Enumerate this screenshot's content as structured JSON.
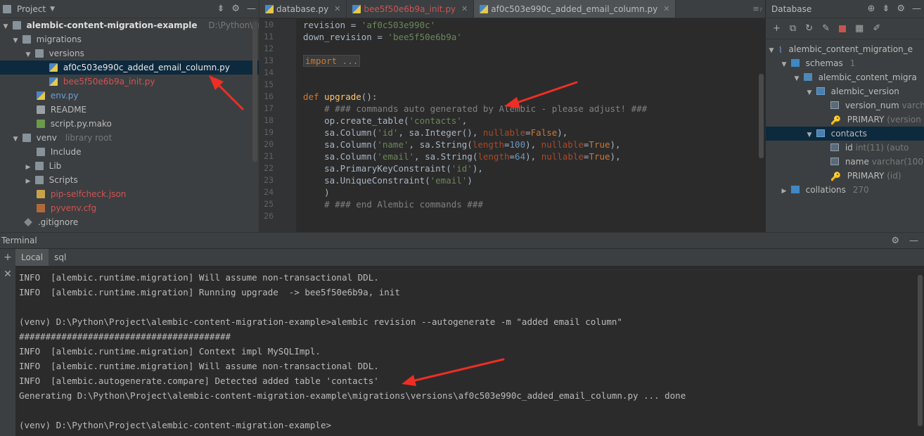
{
  "project": {
    "title": "Project",
    "root": "alembic-content-migration-example",
    "root_path": "D:\\Python\\Proj",
    "items": [
      {
        "label": "migrations",
        "icon": "folder-icon"
      },
      {
        "label": "versions",
        "icon": "folder-icon"
      },
      {
        "label": "af0c503e990c_added_email_column.py",
        "icon": "python-file-icon"
      },
      {
        "label": "bee5f50e6b9a_init.py",
        "icon": "python-file-icon"
      },
      {
        "label": "env.py",
        "icon": "python-file-icon"
      },
      {
        "label": "README",
        "icon": "text-file-icon"
      },
      {
        "label": "script.py.mako",
        "icon": "mako-file-icon"
      },
      {
        "label": "venv",
        "icon": "folder-icon",
        "hint": "library root"
      },
      {
        "label": "Include",
        "icon": "folder-icon"
      },
      {
        "label": "Lib",
        "icon": "folder-icon"
      },
      {
        "label": "Scripts",
        "icon": "folder-icon"
      },
      {
        "label": "pip-selfcheck.json",
        "icon": "json-file-icon"
      },
      {
        "label": "pyvenv.cfg",
        "icon": "cfg-file-icon"
      },
      {
        "label": ".gitignore",
        "icon": "git-file-icon"
      }
    ]
  },
  "editor": {
    "tabs": [
      {
        "label": "database.py"
      },
      {
        "label": "bee5f50e6b9a_init.py"
      },
      {
        "label": "af0c503e990c_added_email_column.py"
      }
    ],
    "tab_overflow": "≡₇",
    "line_numbers": [
      "10",
      "11",
      "12",
      "13",
      "14",
      "15",
      "16",
      "17",
      "18",
      "19",
      "20",
      "21",
      "22",
      "23",
      "24",
      "25",
      "26"
    ]
  },
  "database": {
    "title": "Database",
    "tree": [
      {
        "label": "alembic_content_migration_e",
        "icon": "datasource-icon"
      },
      {
        "label": "schemas",
        "count": "1",
        "icon": "folder-icon"
      },
      {
        "label": "alembic_content_migra",
        "icon": "schema-icon"
      },
      {
        "label": "alembic_version",
        "icon": "table-icon"
      },
      {
        "label": "version_num",
        "type": "varch",
        "icon": "column-key-icon"
      },
      {
        "label": "PRIMARY",
        "type": "(version",
        "icon": "key-icon"
      },
      {
        "label": "contacts",
        "icon": "table-icon"
      },
      {
        "label": "id",
        "type": "int(11) (auto",
        "icon": "column-key-icon"
      },
      {
        "label": "name",
        "type": "varchar(100",
        "icon": "column-icon"
      },
      {
        "label": "PRIMARY",
        "type": "(id)",
        "icon": "key-icon"
      },
      {
        "label": "collations",
        "count": "270",
        "icon": "folder-icon"
      }
    ]
  },
  "terminal": {
    "title": "Terminal",
    "tabs": [
      "Local",
      "sql"
    ],
    "lines": [
      "INFO  [alembic.runtime.migration] Will assume non-transactional DDL.",
      "INFO  [alembic.runtime.migration] Running upgrade  -> bee5f50e6b9a, init",
      "",
      "(venv) D:\\Python\\Project\\alembic-content-migration-example>alembic revision --autogenerate -m \"added email column\"",
      "########################################",
      "INFO  [alembic.runtime.migration] Context impl MySQLImpl.",
      "INFO  [alembic.runtime.migration] Will assume non-transactional DDL.",
      "INFO  [alembic.autogenerate.compare] Detected added table 'contacts'",
      "Generating D:\\Python\\Project\\alembic-content-migration-example\\migrations\\versions\\af0c503e990c_added_email_column.py ... done",
      "",
      "(venv) D:\\Python\\Project\\alembic-content-migration-example>"
    ]
  },
  "colors": {
    "annotation_arrow": "#ee2e24",
    "modified_file": "#d25252",
    "selection": "#0d293e"
  }
}
